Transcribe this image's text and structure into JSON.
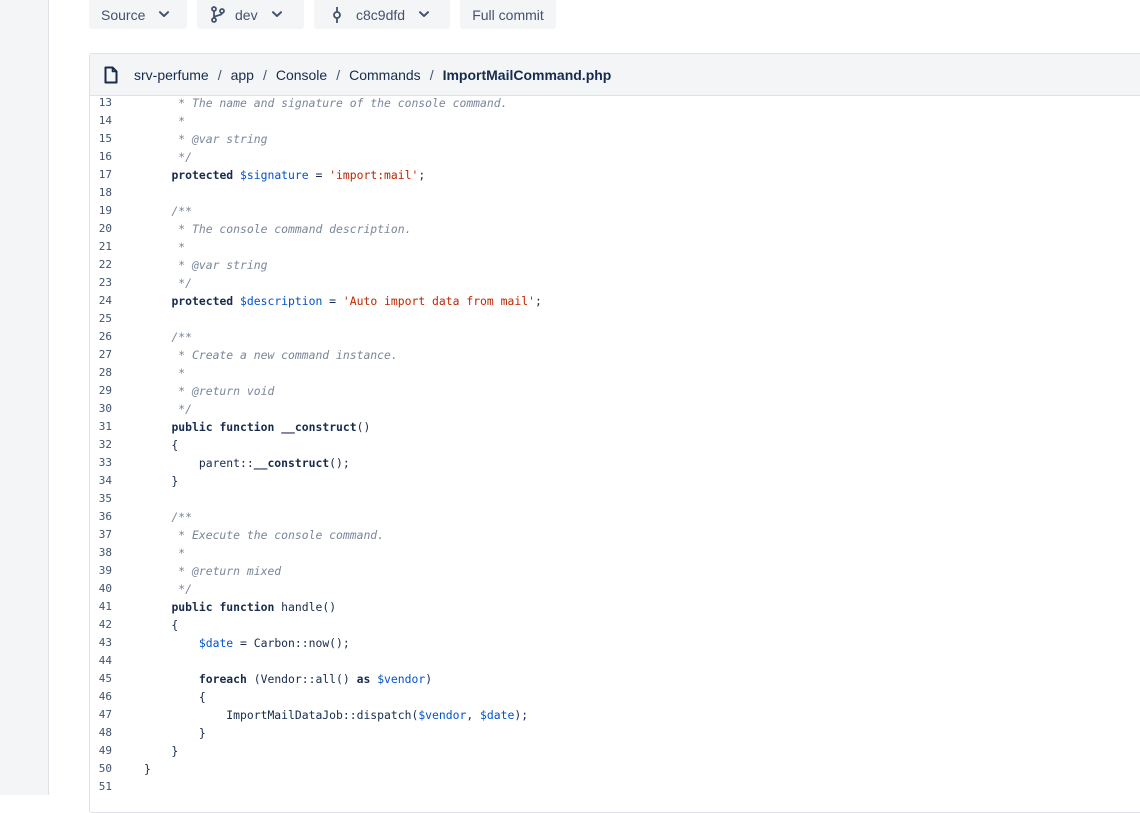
{
  "toolbar": {
    "source_label": "Source",
    "branch_label": "dev",
    "commit_label": "c8c9dfd",
    "full_commit_label": "Full commit"
  },
  "breadcrumb": {
    "items": [
      "srv-perfume",
      "app",
      "Console",
      "Commands",
      "ImportMailCommand.php"
    ],
    "separator": "/"
  },
  "code": {
    "lines": [
      {
        "n": "13",
        "segs": [
          [
            "c",
            "     * The name and signature of the console command."
          ]
        ]
      },
      {
        "n": "14",
        "segs": [
          [
            "c",
            "     *"
          ]
        ]
      },
      {
        "n": "15",
        "segs": [
          [
            "c",
            "     * @var string"
          ]
        ]
      },
      {
        "n": "16",
        "segs": [
          [
            "c",
            "     */"
          ]
        ]
      },
      {
        "n": "17",
        "segs": [
          [
            "t",
            "    "
          ],
          [
            "k",
            "protected"
          ],
          [
            "t",
            " "
          ],
          [
            "v",
            "$signature"
          ],
          [
            "t",
            " = "
          ],
          [
            "s",
            "'import:mail'"
          ],
          [
            "t",
            ";"
          ]
        ]
      },
      {
        "n": "18",
        "segs": []
      },
      {
        "n": "19",
        "segs": [
          [
            "c",
            "    /**"
          ]
        ]
      },
      {
        "n": "20",
        "segs": [
          [
            "c",
            "     * The console command description."
          ]
        ]
      },
      {
        "n": "21",
        "segs": [
          [
            "c",
            "     *"
          ]
        ]
      },
      {
        "n": "22",
        "segs": [
          [
            "c",
            "     * @var string"
          ]
        ]
      },
      {
        "n": "23",
        "segs": [
          [
            "c",
            "     */"
          ]
        ]
      },
      {
        "n": "24",
        "segs": [
          [
            "t",
            "    "
          ],
          [
            "k",
            "protected"
          ],
          [
            "t",
            " "
          ],
          [
            "v",
            "$description"
          ],
          [
            "t",
            " = "
          ],
          [
            "s",
            "'Auto import data from mail'"
          ],
          [
            "t",
            ";"
          ]
        ]
      },
      {
        "n": "25",
        "segs": []
      },
      {
        "n": "26",
        "segs": [
          [
            "c",
            "    /**"
          ]
        ]
      },
      {
        "n": "27",
        "segs": [
          [
            "c",
            "     * Create a new command instance."
          ]
        ]
      },
      {
        "n": "28",
        "segs": [
          [
            "c",
            "     *"
          ]
        ]
      },
      {
        "n": "29",
        "segs": [
          [
            "c",
            "     * @return void"
          ]
        ]
      },
      {
        "n": "30",
        "segs": [
          [
            "c",
            "     */"
          ]
        ]
      },
      {
        "n": "31",
        "segs": [
          [
            "t",
            "    "
          ],
          [
            "k",
            "public"
          ],
          [
            "t",
            " "
          ],
          [
            "k",
            "function"
          ],
          [
            "t",
            " "
          ],
          [
            "f",
            "__construct"
          ],
          [
            "t",
            "()"
          ]
        ]
      },
      {
        "n": "32",
        "segs": [
          [
            "t",
            "    {"
          ]
        ]
      },
      {
        "n": "33",
        "segs": [
          [
            "t",
            "        parent::"
          ],
          [
            "f",
            "__construct"
          ],
          [
            "t",
            "();"
          ]
        ]
      },
      {
        "n": "34",
        "segs": [
          [
            "t",
            "    }"
          ]
        ]
      },
      {
        "n": "35",
        "segs": []
      },
      {
        "n": "36",
        "segs": [
          [
            "c",
            "    /**"
          ]
        ]
      },
      {
        "n": "37",
        "segs": [
          [
            "c",
            "     * Execute the console command."
          ]
        ]
      },
      {
        "n": "38",
        "segs": [
          [
            "c",
            "     *"
          ]
        ]
      },
      {
        "n": "39",
        "segs": [
          [
            "c",
            "     * @return mixed"
          ]
        ]
      },
      {
        "n": "40",
        "segs": [
          [
            "c",
            "     */"
          ]
        ]
      },
      {
        "n": "41",
        "segs": [
          [
            "t",
            "    "
          ],
          [
            "k",
            "public"
          ],
          [
            "t",
            " "
          ],
          [
            "k",
            "function"
          ],
          [
            "t",
            " handle()"
          ]
        ]
      },
      {
        "n": "42",
        "segs": [
          [
            "t",
            "    {"
          ]
        ]
      },
      {
        "n": "43",
        "segs": [
          [
            "t",
            "        "
          ],
          [
            "v",
            "$date"
          ],
          [
            "t",
            " = Carbon::now();"
          ]
        ]
      },
      {
        "n": "44",
        "segs": []
      },
      {
        "n": "45",
        "segs": [
          [
            "t",
            "        "
          ],
          [
            "k",
            "foreach"
          ],
          [
            "t",
            " (Vendor::all() "
          ],
          [
            "k",
            "as"
          ],
          [
            "t",
            " "
          ],
          [
            "v",
            "$vendor"
          ],
          [
            "t",
            ")"
          ]
        ]
      },
      {
        "n": "46",
        "segs": [
          [
            "t",
            "        {"
          ]
        ]
      },
      {
        "n": "47",
        "segs": [
          [
            "t",
            "            ImportMailDataJob::dispatch("
          ],
          [
            "v",
            "$vendor"
          ],
          [
            "t",
            ", "
          ],
          [
            "v",
            "$date"
          ],
          [
            "t",
            ");"
          ]
        ]
      },
      {
        "n": "48",
        "segs": [
          [
            "t",
            "        }"
          ]
        ]
      },
      {
        "n": "49",
        "segs": [
          [
            "t",
            "    }"
          ]
        ]
      },
      {
        "n": "50",
        "segs": [
          [
            "t",
            "}"
          ]
        ]
      },
      {
        "n": "51",
        "segs": []
      }
    ]
  },
  "icons": {
    "branch": "branch-icon",
    "commit": "commit-icon",
    "file": "file-icon",
    "chevron": "chevron-down-icon"
  },
  "colors": {
    "comment": "#7a869a",
    "variable": "#0052cc",
    "string": "#bf2600",
    "text": "#172b4d"
  }
}
